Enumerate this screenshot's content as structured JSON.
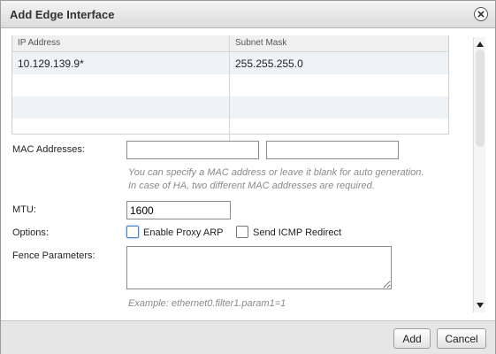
{
  "dialog": {
    "title": "Add Edge Interface"
  },
  "ip_table": {
    "columns": [
      "IP Address",
      "Subnet Mask"
    ],
    "rows": [
      [
        "10.129.139.9*",
        "255.255.255.0"
      ],
      [
        "",
        ""
      ],
      [
        "",
        ""
      ],
      [
        "",
        ""
      ]
    ]
  },
  "mac": {
    "label": "MAC Addresses:",
    "value1": "",
    "value2": "",
    "hint_line1": "You can specify a MAC address or leave it blank for auto generation.",
    "hint_line2": "In case of HA, two different MAC addresses are required."
  },
  "mtu": {
    "label": "MTU:",
    "value": "1600"
  },
  "options": {
    "label": "Options:",
    "enable_proxy_arp": "Enable Proxy ARP",
    "send_icmp_redirect": "Send ICMP Redirect"
  },
  "fence": {
    "label": "Fence Parameters:",
    "value": "",
    "hint": "Example: ethernet0.filter1.param1=1"
  },
  "footer": {
    "add_label": "Add",
    "cancel_label": "Cancel"
  },
  "icons": {
    "close": "close-icon",
    "scroll_up": "arrow-up-icon",
    "scroll_down": "arrow-down-icon"
  }
}
